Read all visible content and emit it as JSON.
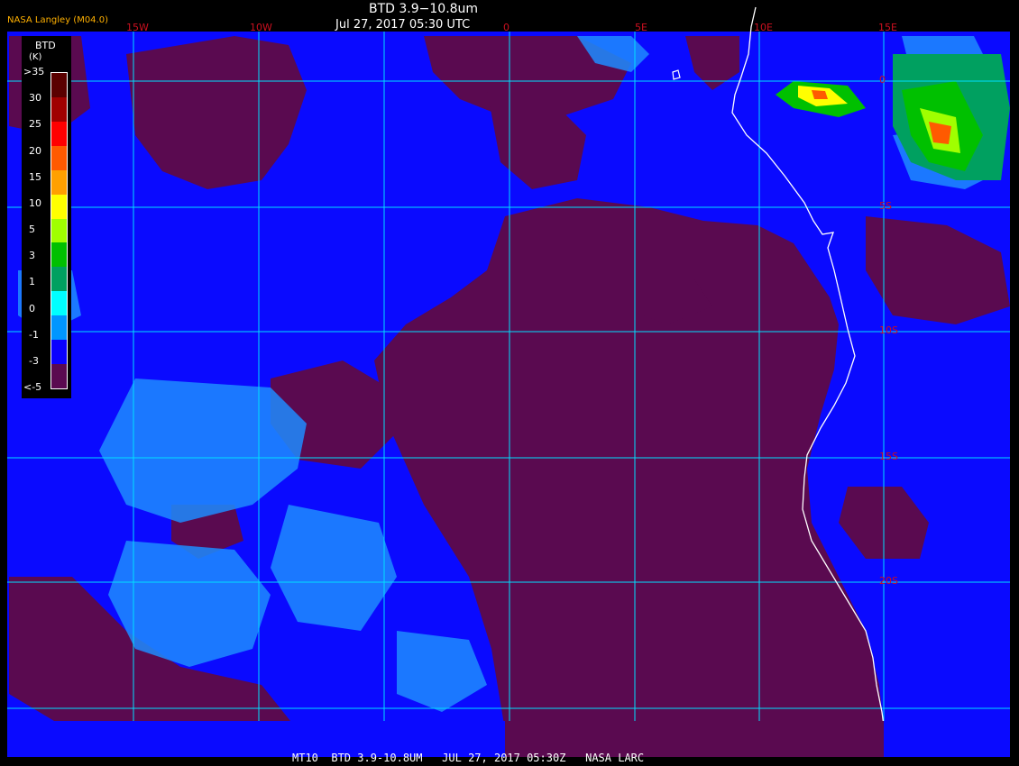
{
  "header": {
    "product_title": "BTD 3.9−10.8um",
    "timestamp": "Jul 27, 2017 05:30 UTC",
    "source_label": "NASA Langley (M04.0)"
  },
  "footer": {
    "caption": "MT10  BTD 3.9-10.8UM   JUL 27, 2017 05:30Z   NASA LARC"
  },
  "legend": {
    "title": "BTD",
    "units": "(K)",
    "ticks": [
      ">35",
      "30",
      "25",
      "20",
      "15",
      "10",
      "5",
      "3",
      "1",
      "0",
      "-1",
      "-3",
      "<-5"
    ],
    "colors": [
      "#5a0000",
      "#a00000",
      "#ff0000",
      "#ff5a00",
      "#ffa000",
      "#ffff00",
      "#a0ff00",
      "#00c000",
      "#00a060",
      "#00ffff",
      "#0096ff",
      "#0a00ff",
      "#5a0a50"
    ]
  },
  "map": {
    "longitude_labels": [
      "15W",
      "10W",
      "0",
      "5E",
      "10E",
      "15E"
    ],
    "latitude_labels": [
      "0",
      "5S",
      "10S",
      "15S",
      "20S"
    ],
    "colors": {
      "ocean_cloud_free": "#5a0a50",
      "low_cloud": "#0a0aff",
      "light_blue": "#1e8cff",
      "gridline": "#00e0ff",
      "coastline": "#ffffff",
      "label": "#cc1020"
    }
  }
}
